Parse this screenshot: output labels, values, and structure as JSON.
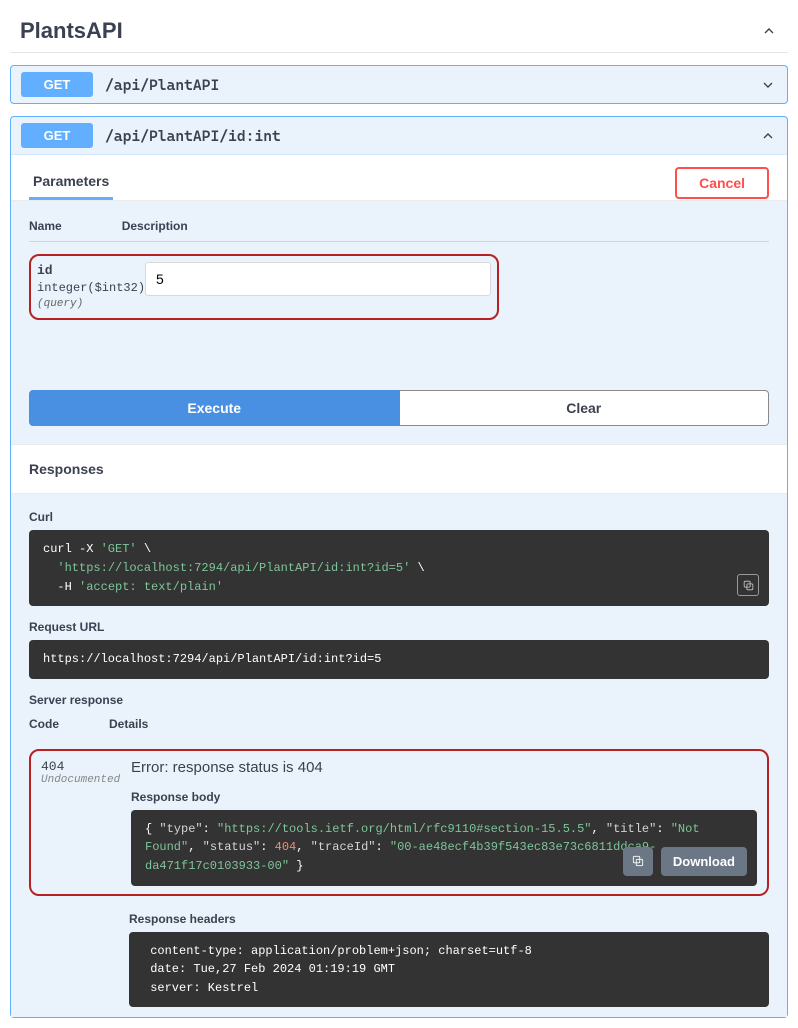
{
  "section": {
    "title": "PlantsAPI"
  },
  "endpoints": [
    {
      "method": "GET",
      "path": "/api/PlantAPI",
      "expanded": false
    },
    {
      "method": "GET",
      "path": "/api/PlantAPI/id:int",
      "expanded": true
    }
  ],
  "tabs": {
    "parameters": "Parameters",
    "cancel": "Cancel"
  },
  "paramTable": {
    "colName": "Name",
    "colDesc": "Description",
    "row": {
      "name": "id",
      "type": "integer($int32)",
      "loc": "(query)",
      "value": "5"
    }
  },
  "buttons": {
    "execute": "Execute",
    "clear": "Clear",
    "download": "Download"
  },
  "responses": {
    "title": "Responses",
    "curlLabel": "Curl",
    "curlLine1a": "curl -X ",
    "curlLine1b": "'GET'",
    "curlLine2": "'https://localhost:7294/api/PlantAPI/id:int?id=5'",
    "curlLine3a": "-H ",
    "curlLine3b": "'accept: text/plain'",
    "reqUrlLabel": "Request URL",
    "reqUrl": "https://localhost:7294/api/PlantAPI/id:int?id=5",
    "serverResp": "Server response",
    "codeCol": "Code",
    "detailsCol": "Details",
    "statusCode": "404",
    "undoc": "Undocumented",
    "errorMsg": "Error: response status is 404",
    "bodyLabel": "Response body",
    "body": {
      "type_k": "\"type\"",
      "type_v": "\"https://tools.ietf.org/html/rfc9110#section-15.5.5\"",
      "title_k": "\"title\"",
      "title_v": "\"Not Found\"",
      "status_k": "\"status\"",
      "status_v": "404",
      "trace_k": "\"traceId\"",
      "trace_v": "\"00-ae48ecf4b39f543ec83e73c6811ddca9-da471f17c0103933-00\""
    },
    "headersLabel": "Response headers",
    "headersText": " content-type: application/problem+json; charset=utf-8 \n date: Tue,27 Feb 2024 01:19:19 GMT \n server: Kestrel "
  }
}
